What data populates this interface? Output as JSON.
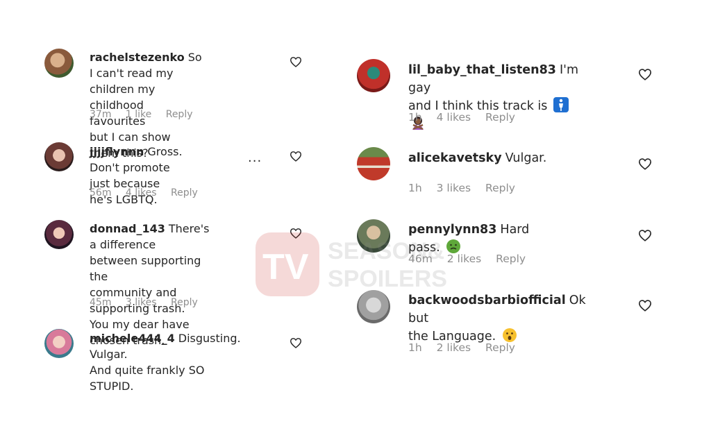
{
  "comments": [
    {
      "username": "rachelstezenko",
      "lines": [
        "So I can't read my",
        "children my childhood favourites",
        "but I can show them this?"
      ],
      "time": "37m",
      "likes": "1 like",
      "reply": "Reply"
    },
    {
      "username": "jjjjflynnn",
      "lines": [
        "Gross. Don't promote",
        "just because he's LGBTQ."
      ],
      "time": "56m",
      "likes": "4 likes",
      "reply": "Reply"
    },
    {
      "username": "donnad_143",
      "lines": [
        "There's a difference",
        "between supporting the",
        "community and supporting trash.",
        "You my dear have chosen trash."
      ],
      "time": "45m",
      "likes": "3 likes",
      "reply": "Reply"
    },
    {
      "username": "michele444_4",
      "lines": [
        "Disgusting. Vulgar.",
        "And quite frankly SO STUPID."
      ]
    },
    {
      "username": "lil_baby_that_listen83",
      "lines": [
        "I'm gay",
        "and I think this track is"
      ],
      "emojis": [
        "restroom-sign-emoji",
        "person-gesturing-no-emoji"
      ],
      "time": "1h",
      "likes": "4 likes",
      "reply": "Reply"
    },
    {
      "username": "alicekavetsky",
      "lines": [
        "Vulgar."
      ],
      "time": "1h",
      "likes": "3 likes",
      "reply": "Reply"
    },
    {
      "username": "pennylynn83",
      "lines": [
        "Hard pass."
      ],
      "emojis": [
        "nauseated-face-emoji"
      ],
      "time": "46m",
      "likes": "2 likes",
      "reply": "Reply"
    },
    {
      "username": "backwoodsbarbiofficial",
      "lines": [
        "Ok but",
        "the Language."
      ],
      "emojis": [
        "astonished-face-emoji"
      ],
      "time": "1h",
      "likes": "2 likes",
      "reply": "Reply"
    }
  ],
  "more_indicator": "...",
  "watermark": {
    "line1": "SEASON&",
    "line2": "SPOILERS",
    "logo": "TV"
  }
}
